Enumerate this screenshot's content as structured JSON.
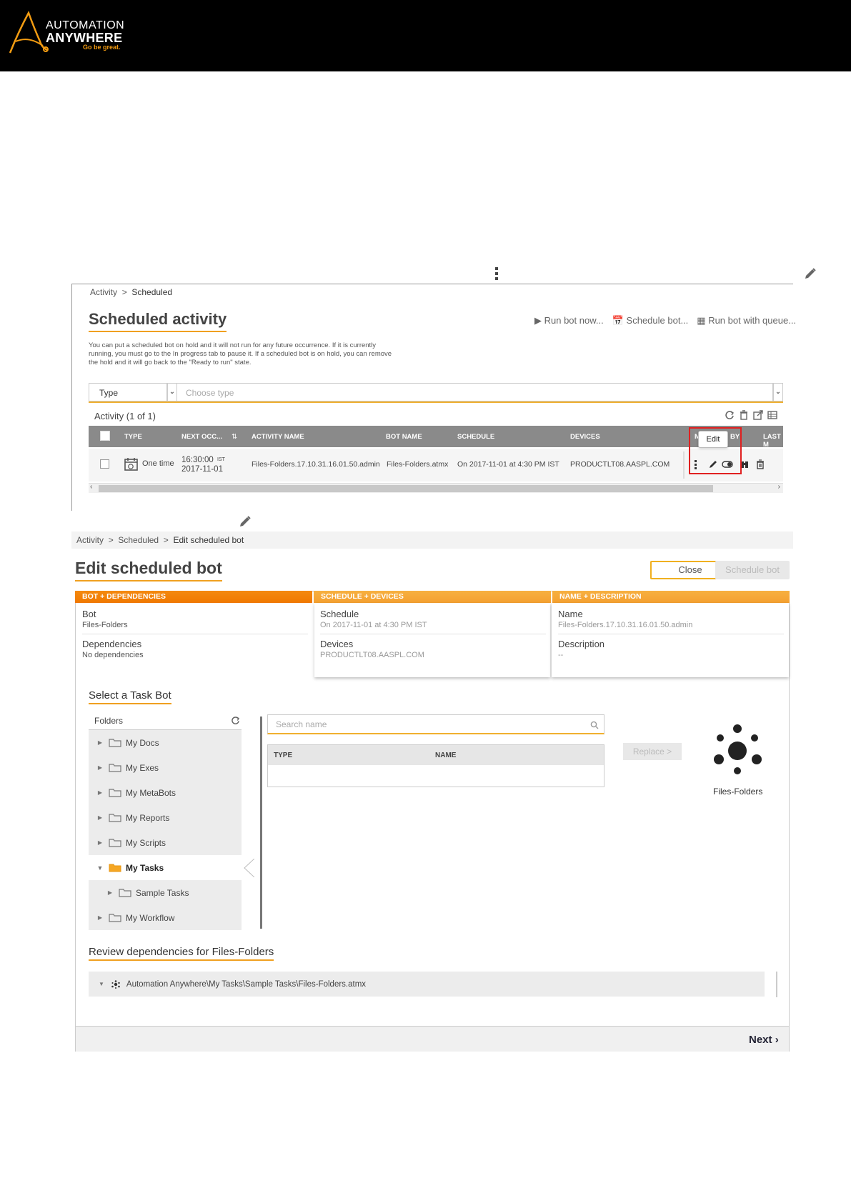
{
  "brand": {
    "line1": "AUTOMATION",
    "line2": "ANYWHERE",
    "tagline": "Go be great.",
    "accent": "#f39c12"
  },
  "screen1": {
    "breadcrumb": [
      "Activity",
      ">",
      "Scheduled"
    ],
    "title": "Scheduled activity",
    "actions": [
      "▶ Run bot now...",
      "Schedule bot...",
      "Run bot with queue..."
    ],
    "description": "You can put a scheduled bot on hold and it will not run for any future occurrence. If it is currently running, you must go to the In progress tab to pause it. If a scheduled bot is on hold, you can remove the hold and it will go back to the \"Ready to run\" state.",
    "filter": {
      "type_label": "Type",
      "placeholder": "Choose type"
    },
    "activity_count": "Activity (1 of 1)",
    "columns": [
      "TYPE",
      "NEXT OCC...",
      "ACTIVITY NAME",
      "BOT NAME",
      "SCHEDULE",
      "DEVICES",
      "M",
      "BY",
      "LAST M"
    ],
    "row": {
      "type": "One time",
      "next_time": "16:30:00",
      "tz": "IST",
      "next_date": "2017-11-01",
      "activity_name": "Files-Folders.17.10.31.16.01.50.admin",
      "bot_name": "Files-Folders.atmx",
      "schedule": "On 2017-11-01 at 4:30 PM IST",
      "devices": "PRODUCTLT08.AASPL.COM"
    },
    "tooltip": "Edit",
    "highlight_color": "#e02020"
  },
  "screen2": {
    "breadcrumb": [
      "Activity",
      ">",
      "Scheduled",
      ">",
      "Edit scheduled bot"
    ],
    "title": "Edit scheduled bot",
    "buttons": {
      "close": "Close",
      "schedule": "Schedule bot"
    },
    "steps": [
      "BOT + DEPENDENCIES",
      "SCHEDULE + DEVICES",
      "NAME + DESCRIPTION"
    ],
    "summary": {
      "bot_label": "Bot",
      "bot_value": "Files-Folders",
      "deps_label": "Dependencies",
      "deps_value": "No dependencies",
      "schedule_label": "Schedule",
      "schedule_value": "On 2017-11-01 at 4:30 PM IST",
      "devices_label": "Devices",
      "devices_value": "PRODUCTLT08.AASPL.COM",
      "name_label": "Name",
      "name_value": "Files-Folders.17.10.31.16.01.50.admin",
      "desc_label": "Description",
      "desc_value": "--"
    },
    "select_heading": "Select a Task Bot",
    "folders_header": "Folders",
    "folders": [
      "My Docs",
      "My Exes",
      "My MetaBots",
      "My Reports",
      "My Scripts",
      "My Tasks",
      "Sample Tasks",
      "My Workflow"
    ],
    "search_placeholder": "Search name",
    "grid_columns": [
      "TYPE",
      "NAME"
    ],
    "replace_label": "Replace >",
    "bot_preview_name": "Files-Folders",
    "review_heading": "Review dependencies for Files-Folders",
    "dependency_path": "Automation Anywhere\\My Tasks\\Sample Tasks\\Files-Folders.atmx",
    "next_label": "Next"
  }
}
